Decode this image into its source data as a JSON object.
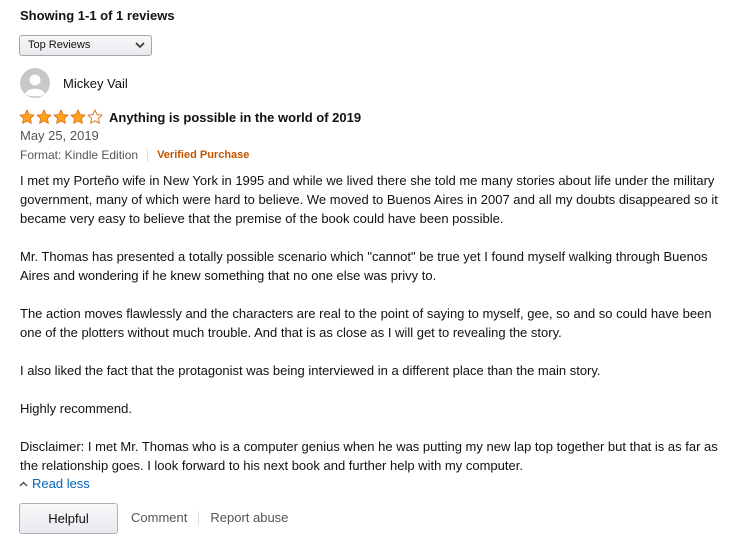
{
  "reviews_summary": "Showing 1-1 of 1 reviews",
  "sort": {
    "selected": "Top Reviews"
  },
  "review": {
    "reviewer": "Mickey Vail",
    "rating": 4,
    "max_rating": 5,
    "title": "Anything is possible in the world of 2019",
    "date": "May 25, 2019",
    "format": "Format: Kindle Edition",
    "verified": "Verified Purchase",
    "paragraphs": [
      "I met my Porteño wife in New York in 1995 and while we lived there she told me many stories about life under the military government, many of which were hard to believe. We moved to Buenos Aires in 2007 and all my doubts disappeared so it became very easy to believe that the premise of the book could have been possible.",
      "Mr. Thomas has presented a totally possible scenario which \"cannot\" be true yet I found myself walking through Buenos Aires and wondering if he knew something that no one else was privy to.",
      "The action moves flawlessly and the characters are real to the point of saying to myself, gee, so and so could have been one of the plotters without much trouble. And that is as close as I will get to revealing the story.",
      "I also liked the fact that the protagonist was being interviewed in a different place than the main story.",
      "Highly recommend.",
      "Disclaimer: I met Mr. Thomas who is a computer genius when he was putting my new lap top together but that is as far as the relationship goes. I look forward to his next book and further help with my computer."
    ]
  },
  "actions": {
    "read_less": "Read less",
    "helpful": "Helpful",
    "comment": "Comment",
    "report": "Report abuse"
  },
  "colors": {
    "star": "#ffa41c",
    "verified": "#c45500",
    "link": "#0066c0"
  },
  "icons": {
    "avatar": "default-avatar-icon",
    "star": "star-icon",
    "chevron": "chevron-down-icon",
    "read_less": "chevron-up-icon"
  }
}
